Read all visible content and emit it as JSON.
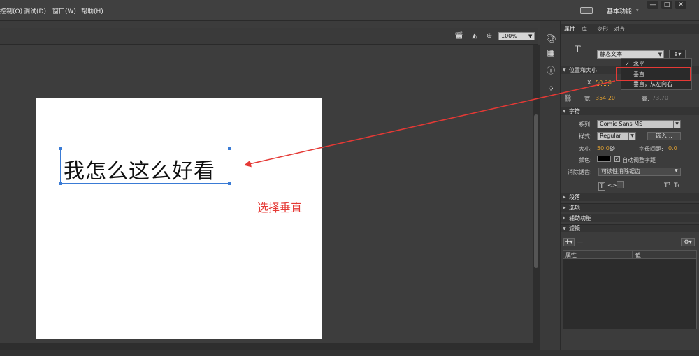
{
  "menu": {
    "items": [
      "控制(O)",
      "调试(D)",
      "窗口(W)",
      "帮助(H)"
    ],
    "workspace": "基本功能",
    "window_controls": [
      "—",
      "□",
      "✕"
    ]
  },
  "stage_toolbar": {
    "zoom": "100%"
  },
  "stage": {
    "text": "我怎么这么好看",
    "annotation": "选择垂直"
  },
  "panel": {
    "tabs": [
      "属性",
      "库",
      "变形",
      "对齐"
    ],
    "text_tool_label": "T",
    "text_type": "静态文本",
    "orientation_menu": {
      "items": [
        "水平",
        "垂直",
        "垂直，从左向右"
      ],
      "checked_index": 0,
      "highlighted_index": 1
    },
    "position_section": {
      "title": "位置和大小",
      "x_label": "X:",
      "x_value": "50.20",
      "w_label": "宽:",
      "w_value": "354.20",
      "h_label": "高:",
      "h_value": "73.70"
    },
    "character_section": {
      "title": "字符",
      "family_label": "系列:",
      "family": "Comic Sans MS",
      "style_label": "样式:",
      "style": "Regular",
      "embed_button": "嵌入...",
      "size_label": "大小:",
      "size_value": "50.0",
      "size_unit": "磅",
      "spacing_label": "字母间距:",
      "spacing_value": "0.0",
      "color_label": "颜色:",
      "auto_kern_label": "自动调整字距",
      "antialias_label": "消除锯齿:",
      "antialias": "可读性消除锯齿"
    },
    "collapsed_sections": [
      "段落",
      "选项",
      "辅助功能"
    ],
    "filter_section": {
      "title": "滤镜",
      "col_property": "属性",
      "col_value": "值"
    }
  },
  "colors": {
    "accent_red": "#e53935",
    "selection_blue": "#3a7bd5",
    "value_orange": "#e0a030"
  }
}
